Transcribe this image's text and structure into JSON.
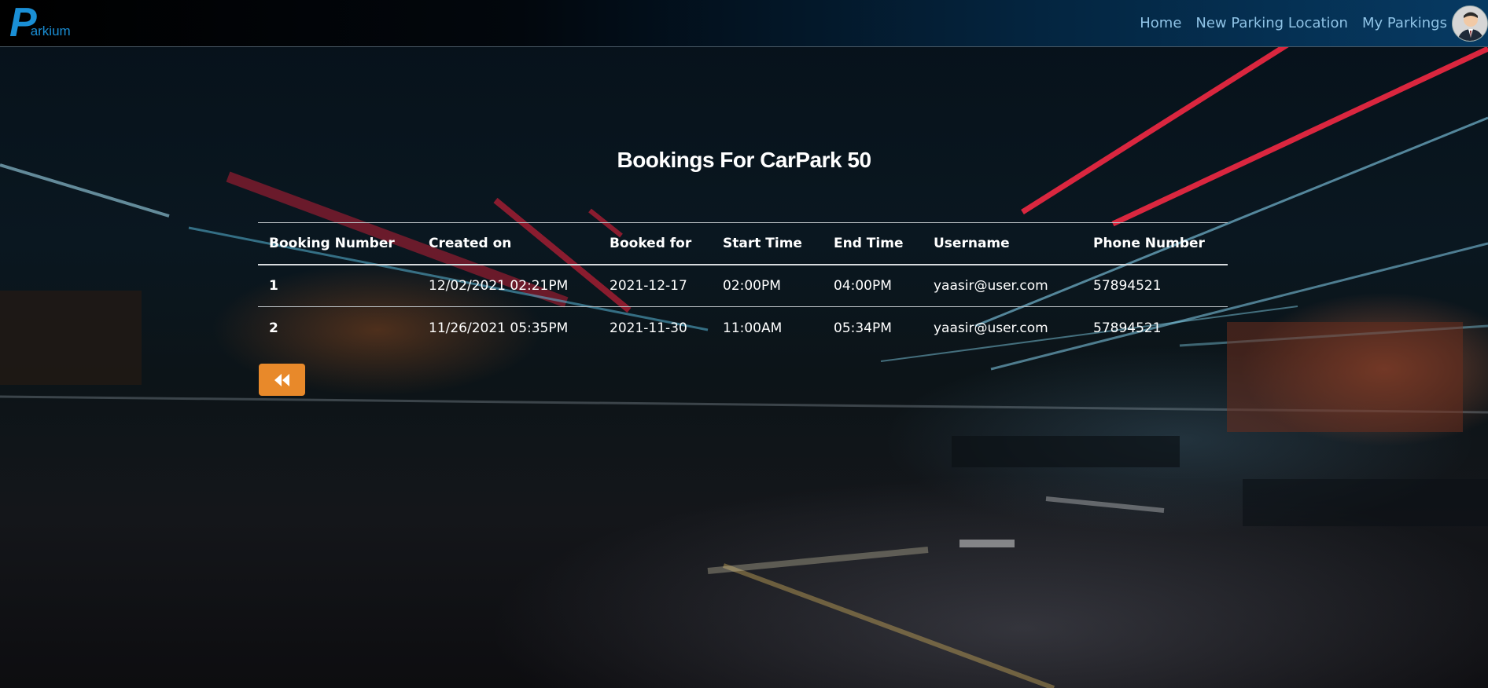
{
  "app": {
    "logo_text": "Parkium"
  },
  "nav": {
    "items": [
      {
        "label": "Home"
      },
      {
        "label": "New Parking Location"
      },
      {
        "label": "My Parkings"
      }
    ],
    "avatar_icon": "user-avatar-icon"
  },
  "page": {
    "title": "Bookings For CarPark 50"
  },
  "table": {
    "headers": [
      "Booking Number",
      "Created on",
      "Booked for",
      "Start Time",
      "End Time",
      "Username",
      "Phone Number"
    ],
    "rows": [
      [
        "1",
        "12/02/2021 02:21PM",
        "2021-12-17",
        "02:00PM",
        "04:00PM",
        "yaasir@user.com",
        "57894521"
      ],
      [
        "2",
        "11/26/2021 05:35PM",
        "2021-11-30",
        "11:00AM",
        "05:34PM",
        "yaasir@user.com",
        "57894521"
      ]
    ]
  },
  "back_button": {
    "icon": "fast-backward-icon"
  },
  "colors": {
    "accent": "#e8892a",
    "logo": "#1a8fd6",
    "nav_link": "#8fc3e6"
  }
}
